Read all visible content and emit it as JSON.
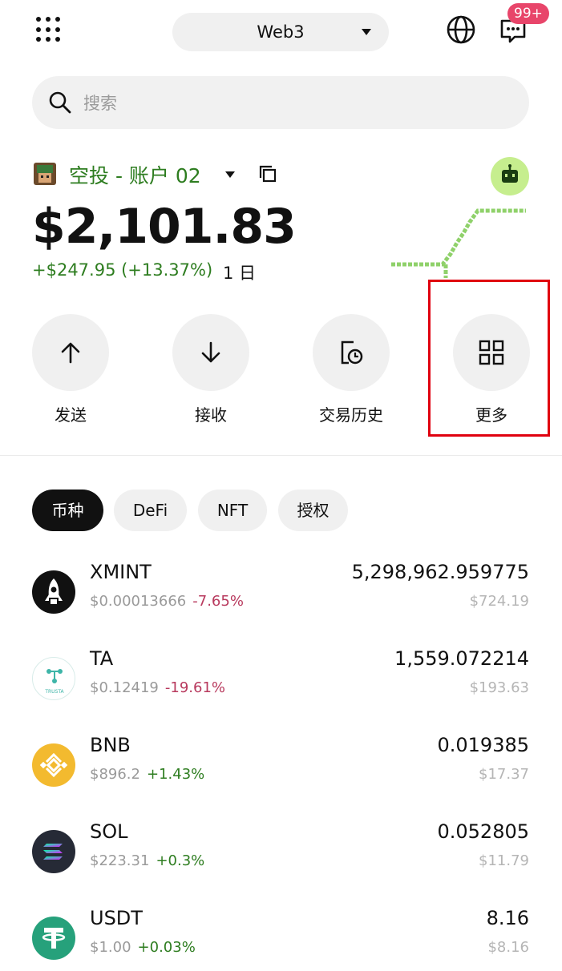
{
  "header": {
    "network": "Web3",
    "badge": "99+"
  },
  "search": {
    "placeholder": "搜索"
  },
  "account": {
    "name": "空投 - 账户 02",
    "balance": "$2,101.83",
    "change": "+$247.95 (+13.37%)",
    "period": "1 日"
  },
  "actions": [
    {
      "label": "发送",
      "icon": "arrow-up-icon"
    },
    {
      "label": "接收",
      "icon": "arrow-down-icon"
    },
    {
      "label": "交易历史",
      "icon": "history-icon"
    },
    {
      "label": "更多",
      "icon": "grid-icon"
    }
  ],
  "tabs": [
    {
      "label": "币种",
      "active": true
    },
    {
      "label": "DeFi",
      "active": false
    },
    {
      "label": "NFT",
      "active": false
    },
    {
      "label": "授权",
      "active": false
    }
  ],
  "tokens": [
    {
      "symbol": "XMINT",
      "price": "$0.00013666",
      "change": "-7.65%",
      "amount": "5,298,962.959775",
      "value": "$724.19",
      "icon": "rocket-icon"
    },
    {
      "symbol": "TA",
      "price": "$0.12419",
      "change": "-19.61%",
      "amount": "1,559.072214",
      "value": "$193.63",
      "icon": "trusta-icon",
      "icon_text": "TRUSTA"
    },
    {
      "symbol": "BNB",
      "price": "$896.2",
      "change": "+1.43%",
      "amount": "0.019385",
      "value": "$17.37",
      "icon": "bnb-icon"
    },
    {
      "symbol": "SOL",
      "price": "$223.31",
      "change": "+0.3%",
      "amount": "0.052805",
      "value": "$11.79",
      "icon": "solana-icon"
    },
    {
      "symbol": "USDT",
      "price": "$1.00",
      "change": "+0.03%",
      "amount": "8.16",
      "value": "$8.16",
      "icon": "tether-icon"
    }
  ],
  "colors": {
    "positive": "#2e7d20",
    "negative": "#b83a5e",
    "highlight": "#e0000f",
    "badge": "#e8456a"
  }
}
